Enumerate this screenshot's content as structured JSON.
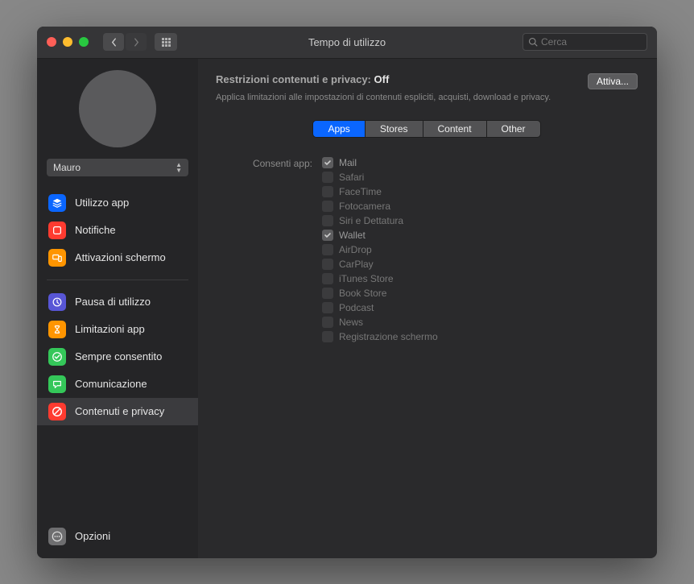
{
  "window_title": "Tempo di utilizzo",
  "search_placeholder": "Cerca",
  "user_select": "Mauro",
  "sidebar": {
    "group1": [
      {
        "label": "Utilizzo app",
        "icon": "layers",
        "bg": "#0a66ff"
      },
      {
        "label": "Notifiche",
        "icon": "bell",
        "bg": "#ff3b30"
      },
      {
        "label": "Attivazioni schermo",
        "icon": "device",
        "bg": "#ff9500"
      }
    ],
    "group2": [
      {
        "label": "Pausa di utilizzo",
        "icon": "clock",
        "bg": "#5856d6"
      },
      {
        "label": "Limitazioni app",
        "icon": "hourglass",
        "bg": "#ff9500"
      },
      {
        "label": "Sempre consentito",
        "icon": "check",
        "bg": "#34c759"
      },
      {
        "label": "Comunicazione",
        "icon": "chat",
        "bg": "#34c759"
      },
      {
        "label": "Contenuti e privacy",
        "icon": "stop",
        "bg": "#ff3b30"
      }
    ],
    "options_label": "Opzioni"
  },
  "header": {
    "prefix": "Restrizioni contenuti e privacy: ",
    "state": "Off",
    "subtitle": "Applica limitazioni alle impostazioni di contenuti espliciti, acquisti, download e privacy.",
    "activate_button": "Attiva..."
  },
  "segments": [
    "Apps",
    "Stores",
    "Content",
    "Other"
  ],
  "segment_selected": 0,
  "form_label": "Consenti app:",
  "apps": [
    {
      "label": "Mail",
      "checked": true
    },
    {
      "label": "Safari",
      "checked": false
    },
    {
      "label": "FaceTime",
      "checked": false
    },
    {
      "label": "Fotocamera",
      "checked": false
    },
    {
      "label": "Siri e Dettatura",
      "checked": false
    },
    {
      "label": "Wallet",
      "checked": true
    },
    {
      "label": "AirDrop",
      "checked": false
    },
    {
      "label": "CarPlay",
      "checked": false
    },
    {
      "label": "iTunes Store",
      "checked": false
    },
    {
      "label": "Book Store",
      "checked": false
    },
    {
      "label": "Podcast",
      "checked": false
    },
    {
      "label": "News",
      "checked": false
    },
    {
      "label": "Registrazione schermo",
      "checked": false
    }
  ]
}
